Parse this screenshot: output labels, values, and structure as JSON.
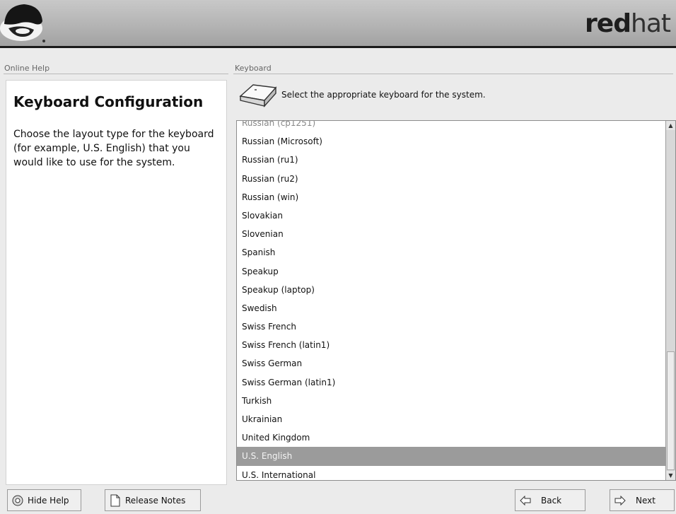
{
  "header": {
    "brand_bold": "red",
    "brand_light": "hat",
    "logo_icon": "shadowman-logo-icon"
  },
  "help": {
    "frame_label": "Online Help",
    "title": "Keyboard Configuration",
    "body": "Choose the layout type for the keyboard (for example, U.S. English) that you would like to use for the system."
  },
  "keyboard": {
    "frame_label": "Keyboard",
    "icon": "keyboard-key-icon",
    "prompt": "Select the appropriate keyboard for the system.",
    "partial_item": "Russian (cp1251)",
    "items": [
      "Russian (Microsoft)",
      "Russian (ru1)",
      "Russian (ru2)",
      "Russian (win)",
      "Slovakian",
      "Slovenian",
      "Spanish",
      "Speakup",
      "Speakup (laptop)",
      "Swedish",
      "Swiss French",
      "Swiss French (latin1)",
      "Swiss German",
      "Swiss German (latin1)",
      "Turkish",
      "Ukrainian",
      "United Kingdom",
      "U.S. English",
      "U.S. International"
    ],
    "selected": "U.S. English"
  },
  "buttons": {
    "hide_help": "Hide Help",
    "release_notes": "Release Notes",
    "back": "Back",
    "next": "Next"
  },
  "colors": {
    "selection": "#9b9b9b",
    "banner": "#b4b4b4",
    "background": "#ebebeb"
  }
}
